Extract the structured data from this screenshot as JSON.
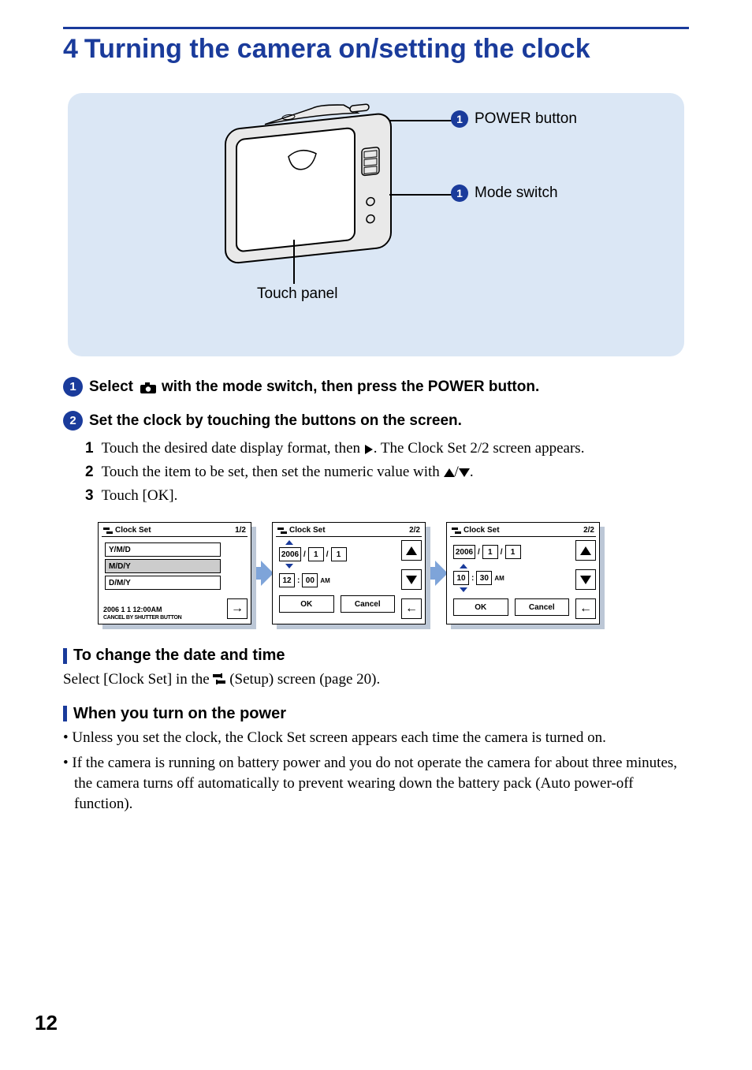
{
  "heading": {
    "num": "4",
    "title": "Turning the camera on/setting the clock"
  },
  "diagram": {
    "power_label": "POWER button",
    "mode_label": "Mode switch",
    "touch_label": "Touch panel"
  },
  "step1": {
    "prefix": "Select",
    "suffix": "with the mode switch, then press the POWER button."
  },
  "step2": {
    "title": "Set the clock by touching the buttons on the screen.",
    "items": [
      {
        "n": "1",
        "a": "Touch the desired date display format, then ",
        "b": ". The Clock Set 2/2 screen appears."
      },
      {
        "n": "2",
        "a": "Touch the item to be set, then set the numeric value with ",
        "b": "."
      },
      {
        "n": "3",
        "a": "Touch [OK].",
        "b": ""
      }
    ]
  },
  "shots": {
    "s1": {
      "title": "Clock Set",
      "page": "1/2",
      "opts": [
        "Y/M/D",
        "M/D/Y",
        "D/M/Y"
      ],
      "footer_date": "2006   1   1   12:00AM",
      "footer_cancel": "CANCEL BY SHUTTER BUTTON"
    },
    "s2": {
      "title": "Clock Set",
      "page": "2/2",
      "year": "2006",
      "m": "1",
      "d": "1",
      "hh": "12",
      "mm": "00",
      "ampm": "AM",
      "ok": "OK",
      "cancel": "Cancel"
    },
    "s3": {
      "title": "Clock Set",
      "page": "2/2",
      "year": "2006",
      "m": "1",
      "d": "1",
      "hh": "10",
      "mm": "30",
      "ampm": "AM",
      "ok": "OK",
      "cancel": "Cancel"
    }
  },
  "change": {
    "heading": "To change the date and time",
    "a": "Select [Clock Set] in the ",
    "b": " (Setup) screen (page 20)."
  },
  "power": {
    "heading": "When you turn on the power",
    "bullets": [
      "Unless you set the clock, the Clock Set screen appears each time the camera is turned on.",
      "If the camera is running on battery power and you do not operate the camera for about three minutes, the camera turns off automatically to prevent wearing down the battery pack (Auto power-off function)."
    ]
  },
  "page_number": "12"
}
